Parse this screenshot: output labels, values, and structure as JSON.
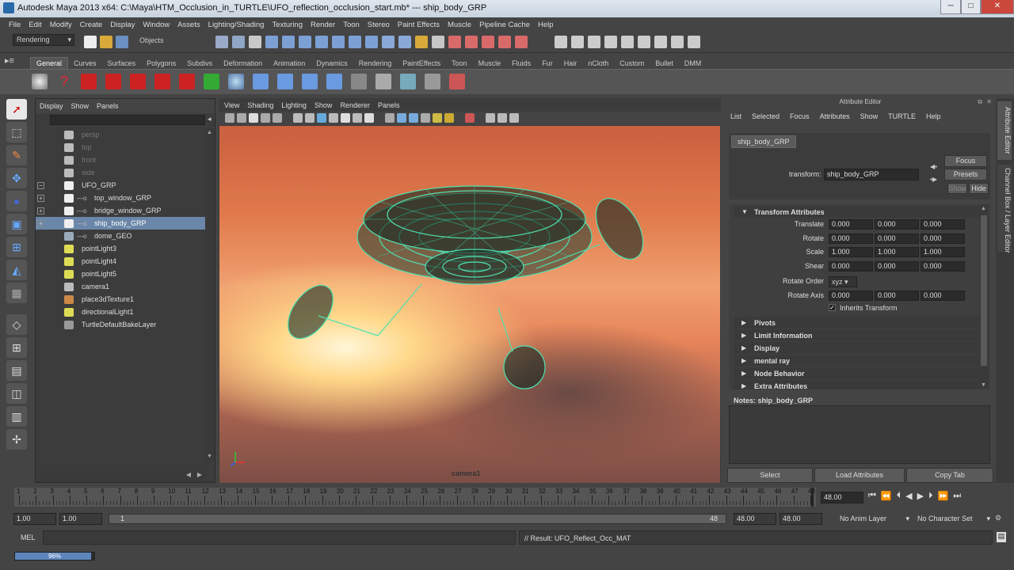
{
  "window": {
    "title": "Autodesk Maya 2013 x64: C:\\Maya\\HTM_Occlusion_in_TURTLE\\UFO_reflection_occlusion_start.mb*  ---  ship_body_GRP",
    "min": "─",
    "max": "□",
    "close": "✕"
  },
  "menubar": [
    "File",
    "Edit",
    "Modify",
    "Create",
    "Display",
    "Window",
    "Assets",
    "Lighting/Shading",
    "Texturing",
    "Render",
    "Toon",
    "Stereo",
    "Paint Effects",
    "Muscle",
    "Pipeline Cache",
    "Help"
  ],
  "status": {
    "menuset": "Rendering",
    "objects_label": "Objects"
  },
  "shelf_tabs": [
    "General",
    "Curves",
    "Surfaces",
    "Polygons",
    "Subdivs",
    "Deformation",
    "Animation",
    "Dynamics",
    "Rendering",
    "PaintEffects",
    "Toon",
    "Muscle",
    "Fluids",
    "Fur",
    "Hair",
    "nCloth",
    "Custom",
    "Bullet",
    "DMM"
  ],
  "shelf_active": "General",
  "outliner": {
    "menu": [
      "Display",
      "Show",
      "Panels"
    ],
    "rows": [
      {
        "name": "persp",
        "icon": "camera-icon",
        "dim": true,
        "sel": false,
        "ind": 0
      },
      {
        "name": "top",
        "icon": "camera-icon",
        "dim": true,
        "sel": false,
        "ind": 0
      },
      {
        "name": "front",
        "icon": "camera-icon",
        "dim": true,
        "sel": false,
        "ind": 0
      },
      {
        "name": "side",
        "icon": "camera-icon",
        "dim": true,
        "sel": false,
        "ind": 0
      },
      {
        "name": "UFO_GRP",
        "icon": "group-icon",
        "dim": false,
        "sel": false,
        "ind": 0,
        "exp": "−"
      },
      {
        "name": "top_window_GRP",
        "icon": "group-icon",
        "dim": false,
        "sel": false,
        "ind": 1,
        "exp": "+"
      },
      {
        "name": "bridge_window_GRP",
        "icon": "group-icon",
        "dim": false,
        "sel": false,
        "ind": 1,
        "exp": "+"
      },
      {
        "name": "ship_body_GRP",
        "icon": "group-icon",
        "dim": false,
        "sel": true,
        "ind": 1,
        "exp": "+"
      },
      {
        "name": "dome_GEO",
        "icon": "mesh-icon",
        "dim": false,
        "sel": false,
        "ind": 1
      },
      {
        "name": "pointLight3",
        "icon": "light-icon",
        "dim": false,
        "sel": false,
        "ind": 0
      },
      {
        "name": "pointLight4",
        "icon": "light-icon",
        "dim": false,
        "sel": false,
        "ind": 0
      },
      {
        "name": "pointLight5",
        "icon": "light-icon",
        "dim": false,
        "sel": false,
        "ind": 0
      },
      {
        "name": "camera1",
        "icon": "camera-icon",
        "dim": false,
        "sel": false,
        "ind": 0
      },
      {
        "name": "place3dTexture1",
        "icon": "texture-icon",
        "dim": false,
        "sel": false,
        "ind": 0
      },
      {
        "name": "directionalLight1",
        "icon": "light-icon",
        "dim": false,
        "sel": false,
        "ind": 0
      },
      {
        "name": "TurtleDefaultBakeLayer",
        "icon": "layer-icon",
        "dim": false,
        "sel": false,
        "ind": 0
      }
    ]
  },
  "viewport": {
    "menu": [
      "View",
      "Shading",
      "Lighting",
      "Show",
      "Renderer",
      "Panels"
    ],
    "camera": "camera1"
  },
  "attr": {
    "title": "Attribute Editor",
    "menu": [
      "List",
      "Selected",
      "Focus",
      "Attributes",
      "Show",
      "TURTLE",
      "Help"
    ],
    "tab": "ship_body_GRP",
    "transform_label": "transform:",
    "transform_value": "ship_body_GRP",
    "focus": "Focus",
    "presets": "Presets",
    "show": "Show",
    "hide": "Hide",
    "section": "Transform Attributes",
    "rows": [
      {
        "label": "Translate",
        "v": [
          "0.000",
          "0.000",
          "0.000"
        ]
      },
      {
        "label": "Rotate",
        "v": [
          "0.000",
          "0.000",
          "0.000"
        ]
      },
      {
        "label": "Scale",
        "v": [
          "1.000",
          "1.000",
          "1.000"
        ]
      },
      {
        "label": "Shear",
        "v": [
          "0.000",
          "0.000",
          "0.000"
        ]
      }
    ],
    "rotate_order_label": "Rotate Order",
    "rotate_order": "xyz",
    "rotate_axis": {
      "label": "Rotate Axis",
      "v": [
        "0.000",
        "0.000",
        "0.000"
      ]
    },
    "inherits": "Inherits Transform",
    "sections": [
      "Pivots",
      "Limit Information",
      "Display",
      "mental ray",
      "Node Behavior",
      "Extra Attributes"
    ],
    "notes": "Notes:  ship_body_GRP",
    "buttons": [
      "Select",
      "Load Attributes",
      "Copy Tab"
    ]
  },
  "sidebar": {
    "tab1": "Attribute Editor",
    "tab2": "Channel Box / Layer Editor"
  },
  "time": {
    "ticks": [
      "1",
      "2",
      "3",
      "4",
      "5",
      "6",
      "7",
      "8",
      "9",
      "10",
      "11",
      "12",
      "13",
      "14",
      "15",
      "16",
      "17",
      "18",
      "19",
      "20",
      "21",
      "22",
      "23",
      "24",
      "25",
      "26",
      "27",
      "28",
      "29",
      "30",
      "31",
      "32",
      "33",
      "34",
      "35",
      "36",
      "37",
      "38",
      "39",
      "40",
      "41",
      "42",
      "43",
      "44",
      "45",
      "46",
      "47",
      "48"
    ],
    "current": "48.00"
  },
  "range": {
    "start": "1.00",
    "start2": "1.00",
    "slider_left": "1",
    "slider_right": "48",
    "end": "48.00",
    "end2": "48.00",
    "anim_layer": "No Anim Layer",
    "char_set": "No Character Set"
  },
  "cmd": {
    "lang": "MEL",
    "result": "// Result: UFO_Reflect_Occ_MAT"
  },
  "help": {
    "progress_text": "96%",
    "progress": 0.96
  }
}
